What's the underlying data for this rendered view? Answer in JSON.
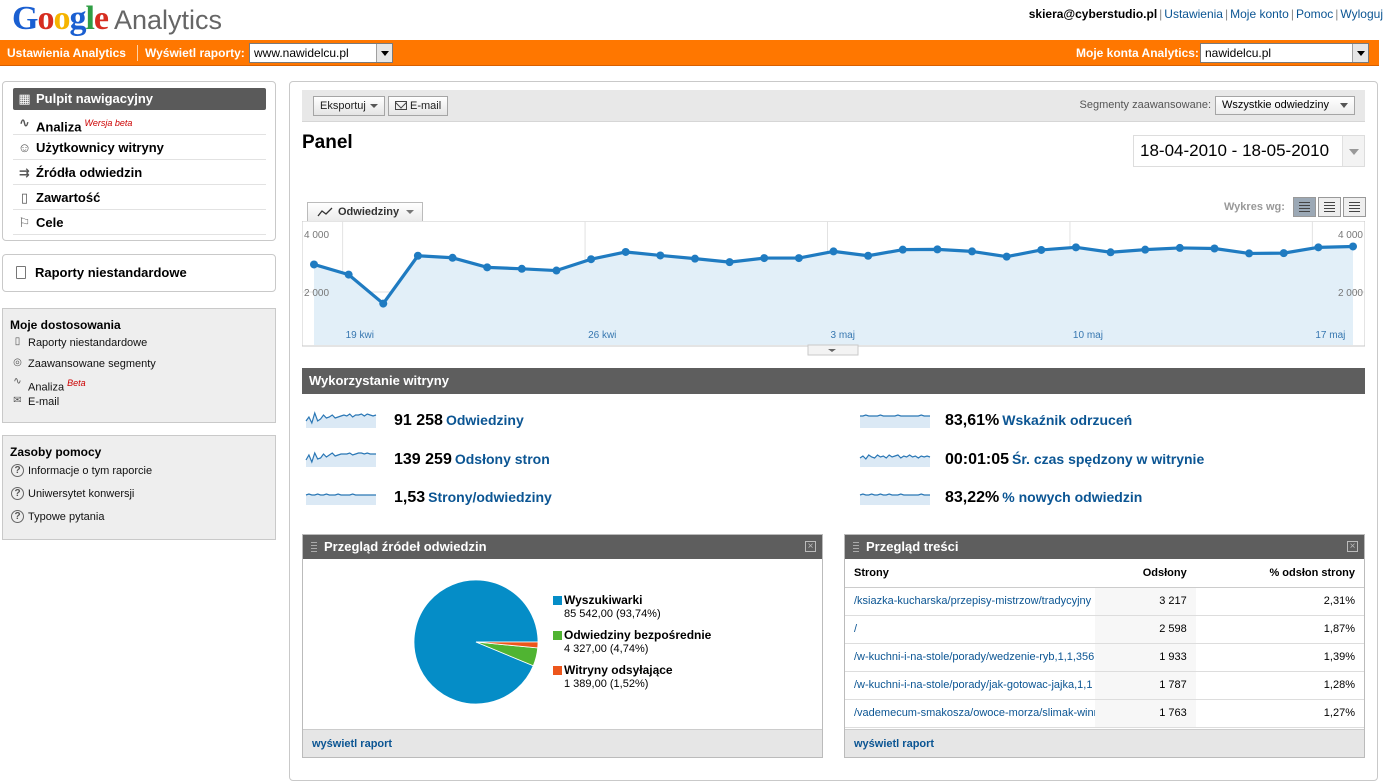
{
  "header": {
    "logo_google": "Google",
    "logo_analytics": "Analytics",
    "user": "skiera@cyberstudio.pl",
    "links": [
      "Ustawienia",
      "Moje konto",
      "Pomoc",
      "Wyloguj"
    ]
  },
  "orangebar": {
    "settings": "Ustawienia Analytics",
    "view_reports_label": "Wyświetl raporty:",
    "view_reports_value": "www.nawidelcu.pl",
    "accounts_label": "Moje konta Analytics:",
    "accounts_value": "nawidelcu.pl"
  },
  "nav": {
    "items": [
      {
        "label": "Pulpit nawigacyjny",
        "icon": "dashboard-icon",
        "active": true
      },
      {
        "label": "Analiza",
        "icon": "analysis-icon",
        "beta": "Wersja beta"
      },
      {
        "label": "Użytkownicy witryny",
        "icon": "user-icon"
      },
      {
        "label": "Źródła odwiedzin",
        "icon": "traffic-sources-icon"
      },
      {
        "label": "Zawartość",
        "icon": "content-icon"
      },
      {
        "label": "Cele",
        "icon": "flag-icon"
      }
    ]
  },
  "custom_reports": "Raporty niestandardowe",
  "my_customizations": {
    "title": "Moje dostosowania",
    "items": [
      "Raporty niestandardowe",
      "Zaawansowane segmenty",
      "Analiza",
      "E-mail"
    ],
    "beta": "Beta"
  },
  "help": {
    "title": "Zasoby pomocy",
    "items": [
      "Informacje o tym raporcie",
      "Uniwersytet konwersji",
      "Typowe pytania"
    ]
  },
  "toolbar": {
    "export": "Eksportuj",
    "email": "E-mail",
    "segments_label": "Segmenty zaawansowane:",
    "segments_value": "Wszystkie odwiedziny"
  },
  "panel_title": "Panel",
  "date_range": "18-04-2010 - 18-05-2010",
  "chart_tab": "Odwiedziny",
  "chart_by": "Wykres wg:",
  "chart_data": {
    "type": "area",
    "series": [
      {
        "name": "Odwiedziny",
        "values": [
          2950,
          2600,
          1600,
          3250,
          3180,
          2850,
          2800,
          2740,
          3130,
          3380,
          3260,
          3150,
          3030,
          3170,
          3170,
          3400,
          3250,
          3460,
          3470,
          3400,
          3220,
          3450,
          3540,
          3370,
          3460,
          3520,
          3500,
          3330,
          3340,
          3540,
          3570
        ]
      }
    ],
    "x_tick_labels": [
      "19 kwi",
      "26 kwi",
      "3 maj",
      "10 maj",
      "17 maj"
    ],
    "x_tick_index": [
      1,
      8,
      15,
      22,
      29
    ],
    "y_tick_labels": [
      "4 000",
      "2 000"
    ],
    "ylim": [
      1600,
      4000
    ],
    "grid": true,
    "legend": "none",
    "color": "#1f7bc1"
  },
  "usage": {
    "title": "Wykorzystanie witryny",
    "metrics": [
      {
        "value": "91 258",
        "label": "Odwiedziny"
      },
      {
        "value": "139 259",
        "label": "Odsłony stron"
      },
      {
        "value": "1,53",
        "label": "Strony/odwiedziny"
      },
      {
        "value": "83,61%",
        "label": "Wskaźnik odrzuceń"
      },
      {
        "value": "00:01:05",
        "label": "Śr. czas spędzony w witrynie"
      },
      {
        "value": "83,22%",
        "label": "% nowych odwiedzin"
      }
    ]
  },
  "sources": {
    "title": "Przegląd źródeł odwiedzin",
    "footer": "wyświetl raport",
    "pie": [
      {
        "name": "Wyszukiwarki",
        "value": "85 542,00 (93,74%)",
        "pct": 93.74,
        "color": "#058dc7"
      },
      {
        "name": "Odwiedziny bezpośrednie",
        "value": "4 327,00 (4,74%)",
        "pct": 4.74,
        "color": "#50b432"
      },
      {
        "name": "Witryny odsyłające",
        "value": "1 389,00 (1,52%)",
        "pct": 1.52,
        "color": "#ed561b"
      }
    ]
  },
  "content": {
    "title": "Przegląd treści",
    "footer": "wyświetl raport",
    "columns": [
      "Strony",
      "Odsłony",
      "% odsłon strony"
    ],
    "rows": [
      [
        "/ksiazka-kucharska/przepisy-mistrzow/tradycyjny",
        "3 217",
        "2,31%"
      ],
      [
        "/",
        "2 598",
        "1,87%"
      ],
      [
        "/w-kuchni-i-na-stole/porady/wedzenie-ryb,1,1,356",
        "1 933",
        "1,39%"
      ],
      [
        "/w-kuchni-i-na-stole/porady/jak-gotowac-jajka,1,1",
        "1 787",
        "1,28%"
      ],
      [
        "/vademecum-smakosza/owoce-morza/slimak-winn",
        "1 763",
        "1,27%"
      ]
    ]
  }
}
